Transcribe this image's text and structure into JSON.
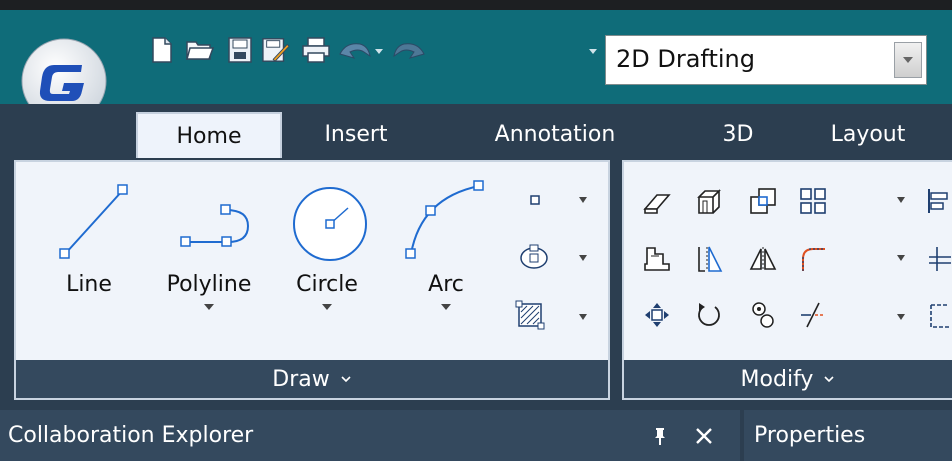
{
  "quick_access": {
    "workspace_value": "2D Drafting"
  },
  "tabs": [
    {
      "label": "Home",
      "active": true
    },
    {
      "label": "Insert",
      "active": false
    },
    {
      "label": "Annotation",
      "active": false
    },
    {
      "label": "3D",
      "active": false
    },
    {
      "label": "Layout",
      "active": false
    }
  ],
  "draw_panel": {
    "title": "Draw",
    "tools": [
      {
        "label": "Line",
        "icon": "line-icon"
      },
      {
        "label": "Polyline",
        "icon": "polyline-icon"
      },
      {
        "label": "Circle",
        "icon": "circle-icon"
      },
      {
        "label": "Arc",
        "icon": "arc-icon"
      }
    ]
  },
  "modify_panel": {
    "title": "Modify"
  },
  "bottom": {
    "left_title": "Collaboration Explorer",
    "right_title": "Properties"
  },
  "colors": {
    "titlebar": "#0f6c79",
    "dark": "#2c3e50",
    "panel": "#f0f4fa",
    "panel_footer": "#34495e"
  }
}
